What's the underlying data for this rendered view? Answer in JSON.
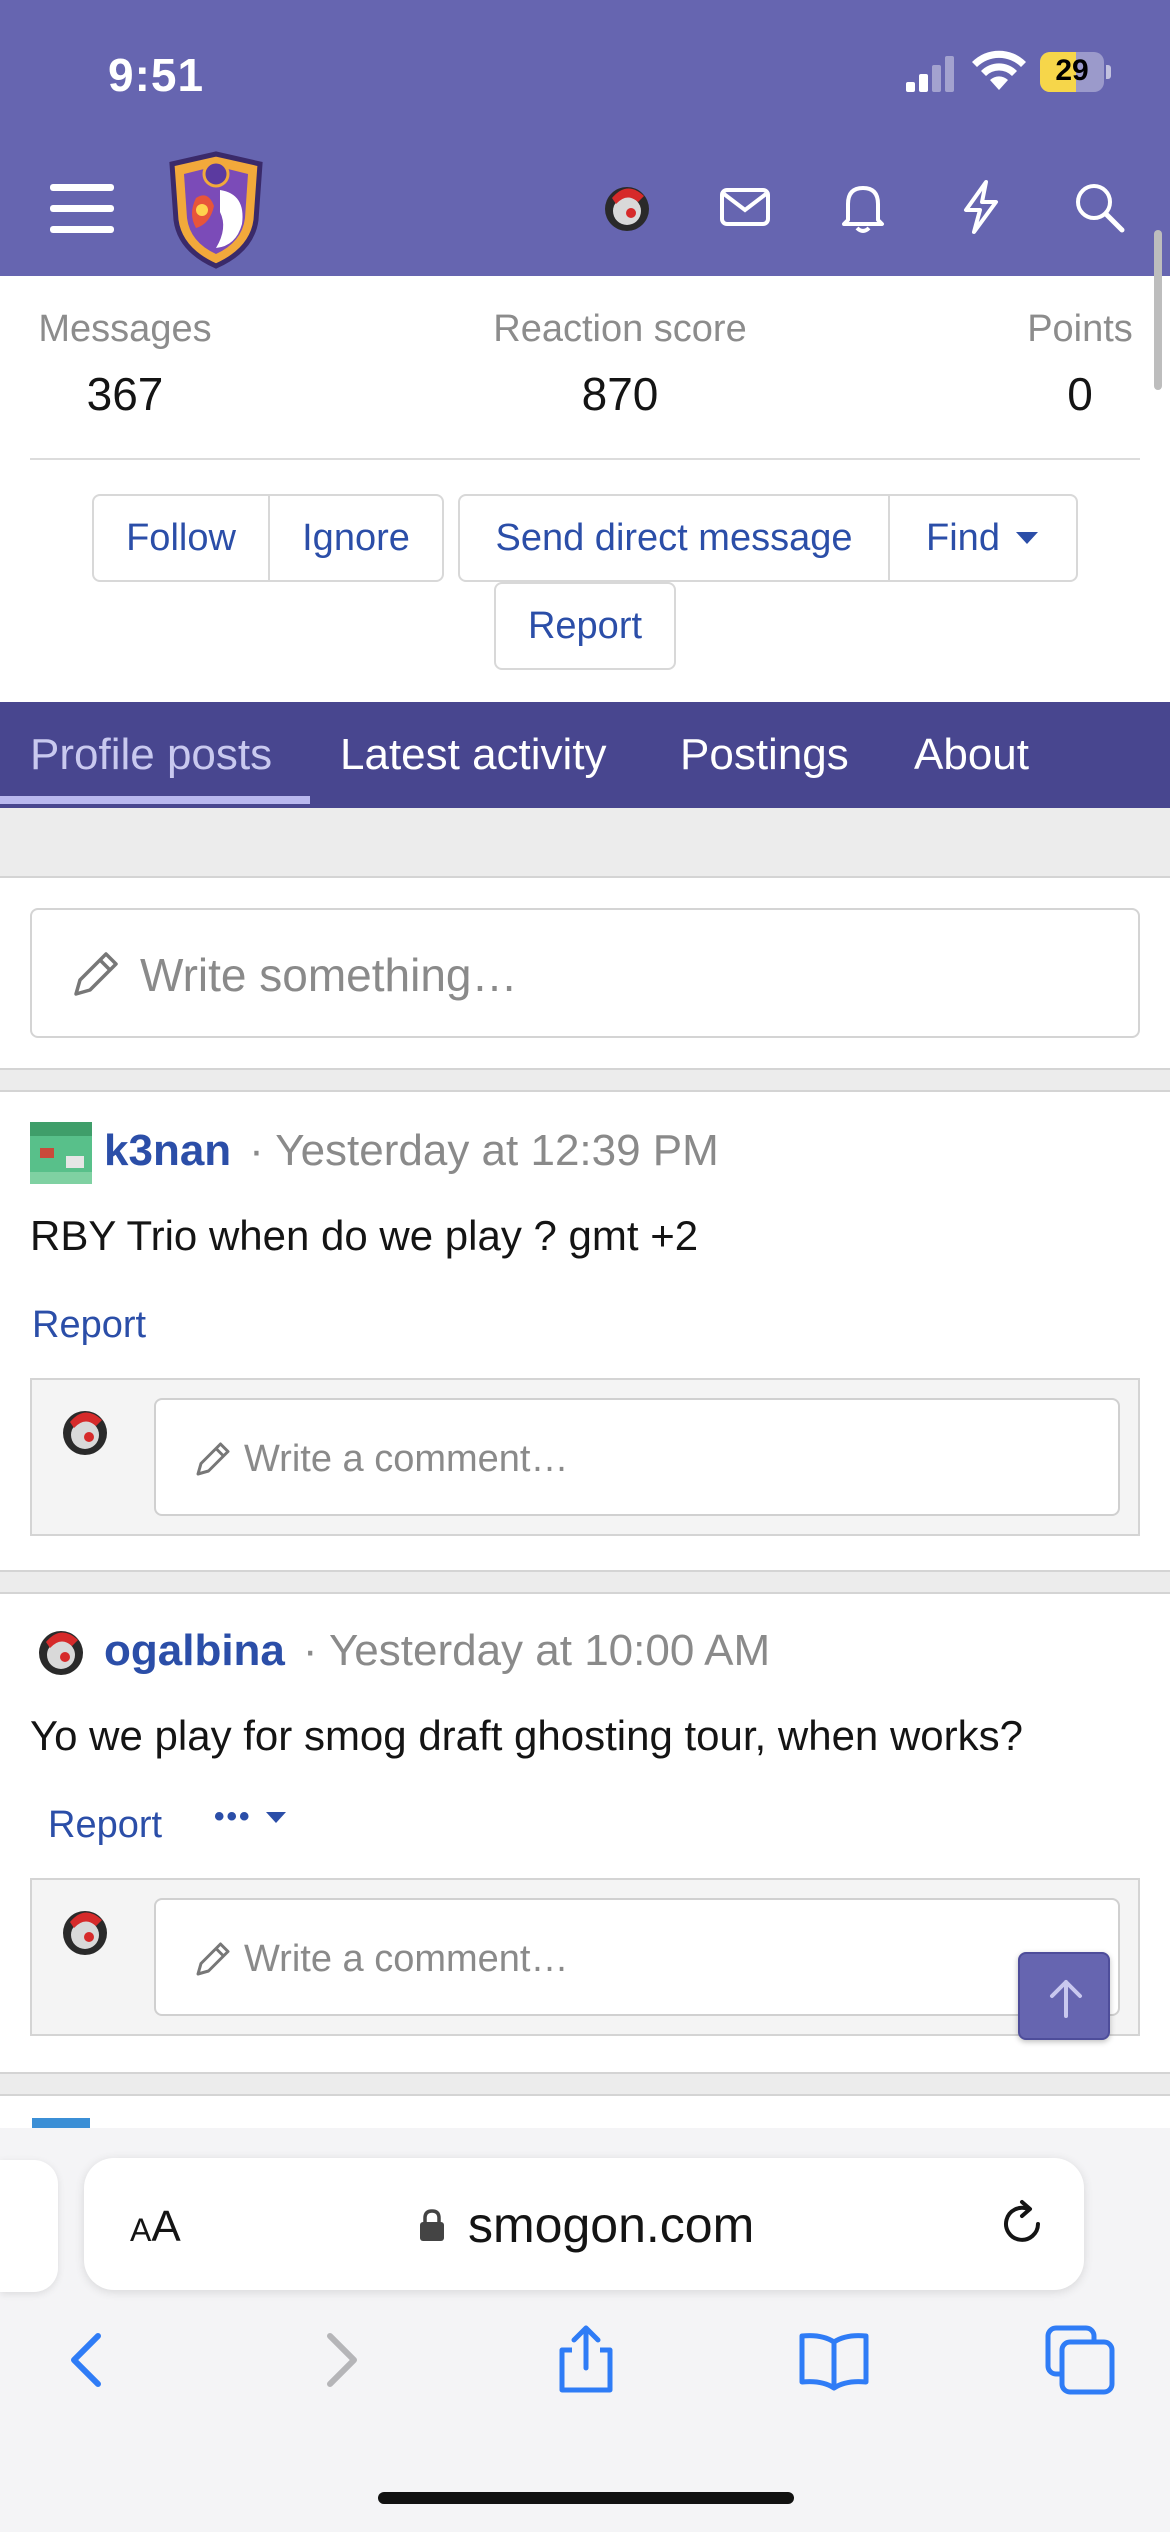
{
  "status_bar": {
    "time": "9:51",
    "battery": "29"
  },
  "header": {
    "icons": [
      "menu-icon",
      "site-logo",
      "user-avatar",
      "envelope-icon",
      "bell-icon",
      "bolt-icon",
      "search-icon"
    ],
    "brand_color": "#6665b0"
  },
  "stats": [
    {
      "label": "Messages",
      "value": "367"
    },
    {
      "label": "Reaction score",
      "value": "870"
    },
    {
      "label": "Points",
      "value": "0"
    }
  ],
  "actions": {
    "follow": "Follow",
    "ignore": "Ignore",
    "send_dm": "Send direct message",
    "find": "Find",
    "report": "Report"
  },
  "tabs": [
    {
      "label": "Profile posts",
      "active": true
    },
    {
      "label": "Latest activity",
      "active": false
    },
    {
      "label": "Postings",
      "active": false
    },
    {
      "label": "About",
      "active": false
    }
  ],
  "composer": {
    "placeholder": "Write something…"
  },
  "posts": [
    {
      "user": "k3nan",
      "meta": "· Yesterday at 12:39 PM",
      "text": "RBY Trio when do we play ? gmt +2",
      "report": "Report",
      "comment_placeholder": "Write a comment…"
    },
    {
      "user": "ogalbina",
      "meta": "· Yesterday at 10:00 AM",
      "text": "Yo we play for smog draft ghosting tour, when works?",
      "report": "Report",
      "more": "•••",
      "comment_placeholder": "Write a comment…"
    }
  ],
  "browser": {
    "text_size_big": "A",
    "text_size_small": "A",
    "url": "smogon.com",
    "toolbar_icons": [
      "back-icon",
      "forward-icon",
      "share-icon",
      "bookmarks-icon",
      "tabs-icon"
    ]
  },
  "colors": {
    "link": "#2b4ea8",
    "tab_bar": "#48468f",
    "header": "#6665b0"
  }
}
